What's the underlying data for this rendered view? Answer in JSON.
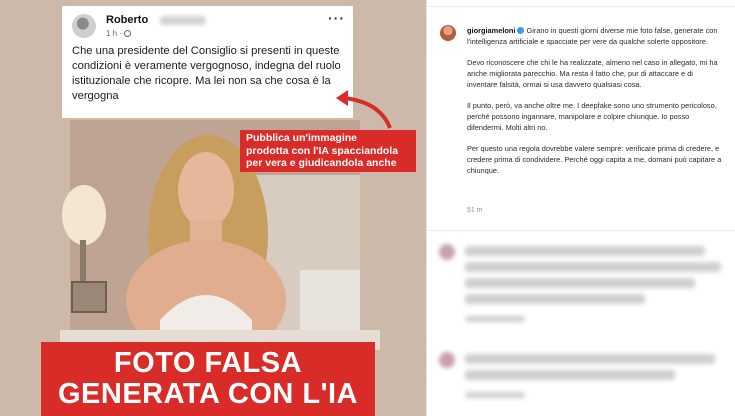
{
  "facebook_post": {
    "author": "Roberto",
    "meta": "1 h ·",
    "text": "Che una presidente del Consiglio  si presenti in queste condizioni è veramente vergognoso, indegna del ruolo istituzionale che ricopre. Ma lei non sa che cosa è la vergogna"
  },
  "callout": {
    "line1": "Pubblica un'immagine",
    "line2": "prodotta con l'IA spacciandola",
    "line3": "per vera e giudicandola anche"
  },
  "banner": {
    "line1": "FOTO FALSA",
    "line2": "GENERATA CON L'IA"
  },
  "instagram": {
    "username": "giorgiameloni",
    "paragraphs": [
      "Girano in questi giorni diverse mie foto false, generate con l'intelligenza artificiale e spacciate per vere da qualche solerte oppositore.",
      "Devo riconoscere che chi le ha realizzate, almeno nel caso in allegato, mi ha anche migliorata parecchio. Ma resta il fatto che, pur di attaccare e di inventare falsità, ormai si usa davvero qualsiasi cosa.",
      "Il punto, però, va anche oltre me. I deepfake sono uno strumento pericoloso, perché possono ingannare, manipolare e colpire chiunque. Io posso difendermi. Molti altri no.",
      "Per questo una regola dovrebbe valere sempre: verificare prima di credere, e credere prima di condividere. Perché oggi capita a me, domani può capitare a chiunque."
    ],
    "timestamp": "51 m"
  },
  "colors": {
    "accent_red": "#d92b27",
    "verified_blue": "#3897f0"
  }
}
